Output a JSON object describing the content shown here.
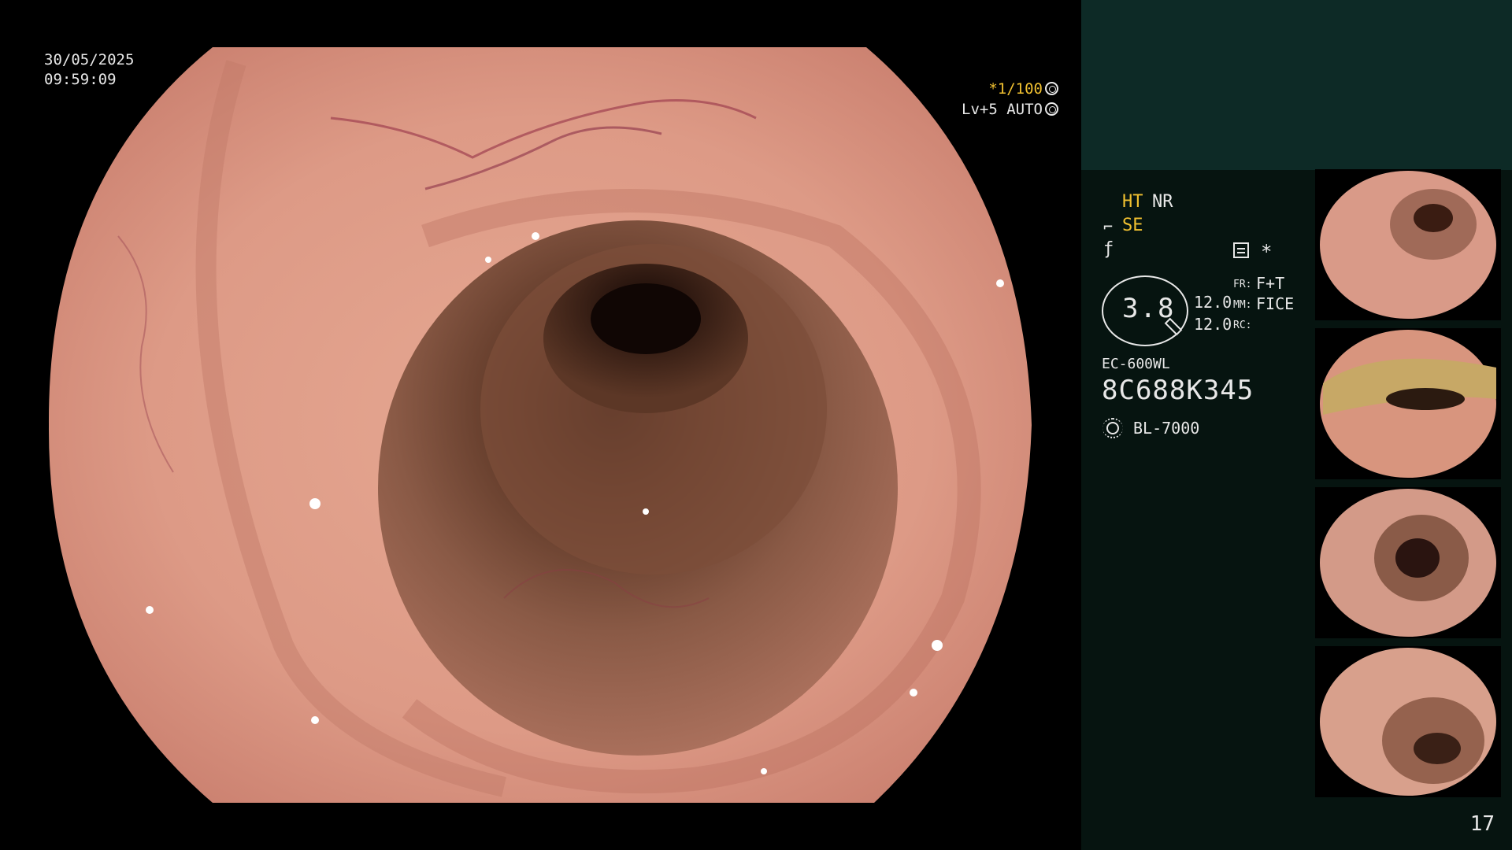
{
  "overlay": {
    "date": "30/05/2025",
    "time": "09:59:09",
    "shutter": "*1/100",
    "iris": "Lv+5 AUTO"
  },
  "panel": {
    "ht": "HT",
    "nr": "NR",
    "se": "SE",
    "asterisk": "*",
    "zoom": "3.8",
    "value_a": "12.0",
    "value_b": "12.0",
    "fr_label": "FR:",
    "fr_value": "F+T",
    "mm_label": "MM:",
    "mm_value": "FICE",
    "rc_label": "RC:",
    "scope_model": "EC-600WL",
    "scope_serial": "8C688K345",
    "light_source": "BL-7000",
    "page_number": "17"
  },
  "colors": {
    "highlight": "#f0c030",
    "panel_background": "#061410",
    "panel_top_background": "#0d2a26",
    "mucosa": "#d99080"
  },
  "icons": [
    "shutter-icon",
    "iris-icon",
    "structure-enhance-icon",
    "edge-icon",
    "grid-icon",
    "light-source-icon"
  ],
  "thumbnails": [
    {
      "name": "thumbnail-1"
    },
    {
      "name": "thumbnail-2"
    },
    {
      "name": "thumbnail-3"
    },
    {
      "name": "thumbnail-4"
    }
  ]
}
